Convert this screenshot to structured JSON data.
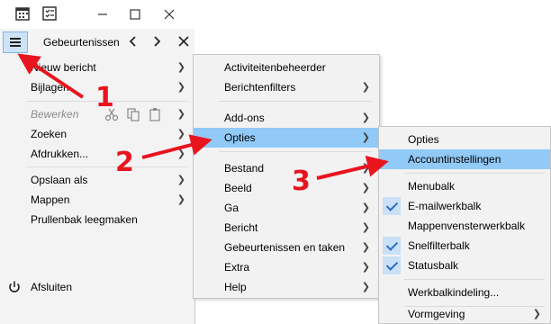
{
  "toolbar": {
    "tab_label": "Gebeurtenissen"
  },
  "main_menu": {
    "items": [
      {
        "label": "Nieuw bericht"
      },
      {
        "label": "Bijlagen"
      },
      {
        "label": "Bewerken"
      },
      {
        "label": "Zoeken"
      },
      {
        "label": "Afdrukken..."
      },
      {
        "label": "Opslaan als"
      },
      {
        "label": "Mappen"
      },
      {
        "label": "Prullenbak leegmaken"
      },
      {
        "label": "Afsluiten"
      }
    ]
  },
  "submenu1": {
    "items": [
      {
        "label": "Activiteitenbeheerder"
      },
      {
        "label": "Berichtenfilters"
      },
      {
        "label": "Add-ons"
      },
      {
        "label": "Opties"
      },
      {
        "label": "Bestand"
      },
      {
        "label": "Beeld"
      },
      {
        "label": "Ga"
      },
      {
        "label": "Bericht"
      },
      {
        "label": "Gebeurtenissen en taken"
      },
      {
        "label": "Extra"
      },
      {
        "label": "Help"
      }
    ]
  },
  "submenu2": {
    "items": [
      {
        "label": "Opties"
      },
      {
        "label": "Accountinstellingen"
      },
      {
        "label": "Menubalk"
      },
      {
        "label": "E-mailwerkbalk"
      },
      {
        "label": "Mappenvensterwerkbalk"
      },
      {
        "label": "Snelfilterbalk"
      },
      {
        "label": "Statusbalk"
      },
      {
        "label": "Werkbalkindeling..."
      },
      {
        "label": "Vormgeving"
      }
    ]
  },
  "annotations": {
    "one": "1",
    "two": "2",
    "three": "3"
  },
  "colors": {
    "highlight": "#91c9f7",
    "annotation": "#e8141e",
    "check": "#2a6fc4"
  }
}
